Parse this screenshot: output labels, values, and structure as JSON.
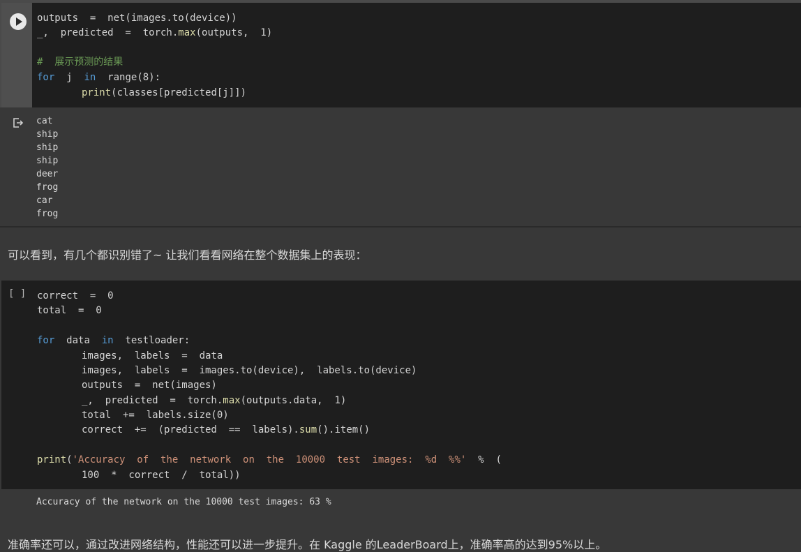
{
  "cell1": {
    "run_button_label": "",
    "code": {
      "l1": "outputs  =  net(images.to(device))",
      "l2a": "_,  predicted  =  torch.",
      "l2b": "max",
      "l2c": "(outputs,  1)",
      "l3": "#  展示预测的结果",
      "l4a": "for",
      "l4b": "  j  ",
      "l4c": "in",
      "l4d": "  range(8):",
      "l5a": "print",
      "l5b": "(classes[predicted[j]])"
    },
    "output": [
      "cat",
      "ship",
      "ship",
      "ship",
      "deer",
      "frog",
      "car",
      "frog"
    ]
  },
  "text1": "可以看到，有几个都识别错了~ 让我们看看网络在整个数据集上的表现：",
  "cell2": {
    "exec_count": "[ ]",
    "code": {
      "l1": "correct  =  0",
      "l2": "total  =  0",
      "l3a": "for",
      "l3b": "  data  ",
      "l3c": "in",
      "l3d": "  testloader:",
      "l4": "images,  labels  =  data",
      "l5": "images,  labels  =  images.to(device),  labels.to(device)",
      "l6": "outputs  =  net(images)",
      "l7a": "_,  predicted  =  torch.",
      "l7b": "max",
      "l7c": "(outputs.data,  1)",
      "l8": "total  +=  labels.size(0)",
      "l9a": "correct  +=  (predicted  ==  labels).",
      "l9b": "sum",
      "l9c": "().item()",
      "l10a": "print",
      "l10b": "(",
      "l10c": "'Accuracy  of  the  network  on  the  10000  test  images:  %d  %%'",
      "l10d": "  %  (",
      "l11": "100  *  correct  /  total))"
    },
    "output": "Accuracy of the network on the 10000 test images: 63 %"
  },
  "text2": "准确率还可以，通过改进网络结构，性能还可以进一步提升。在 Kaggle 的LeaderBoard上，准确率高的达到95%以上。"
}
